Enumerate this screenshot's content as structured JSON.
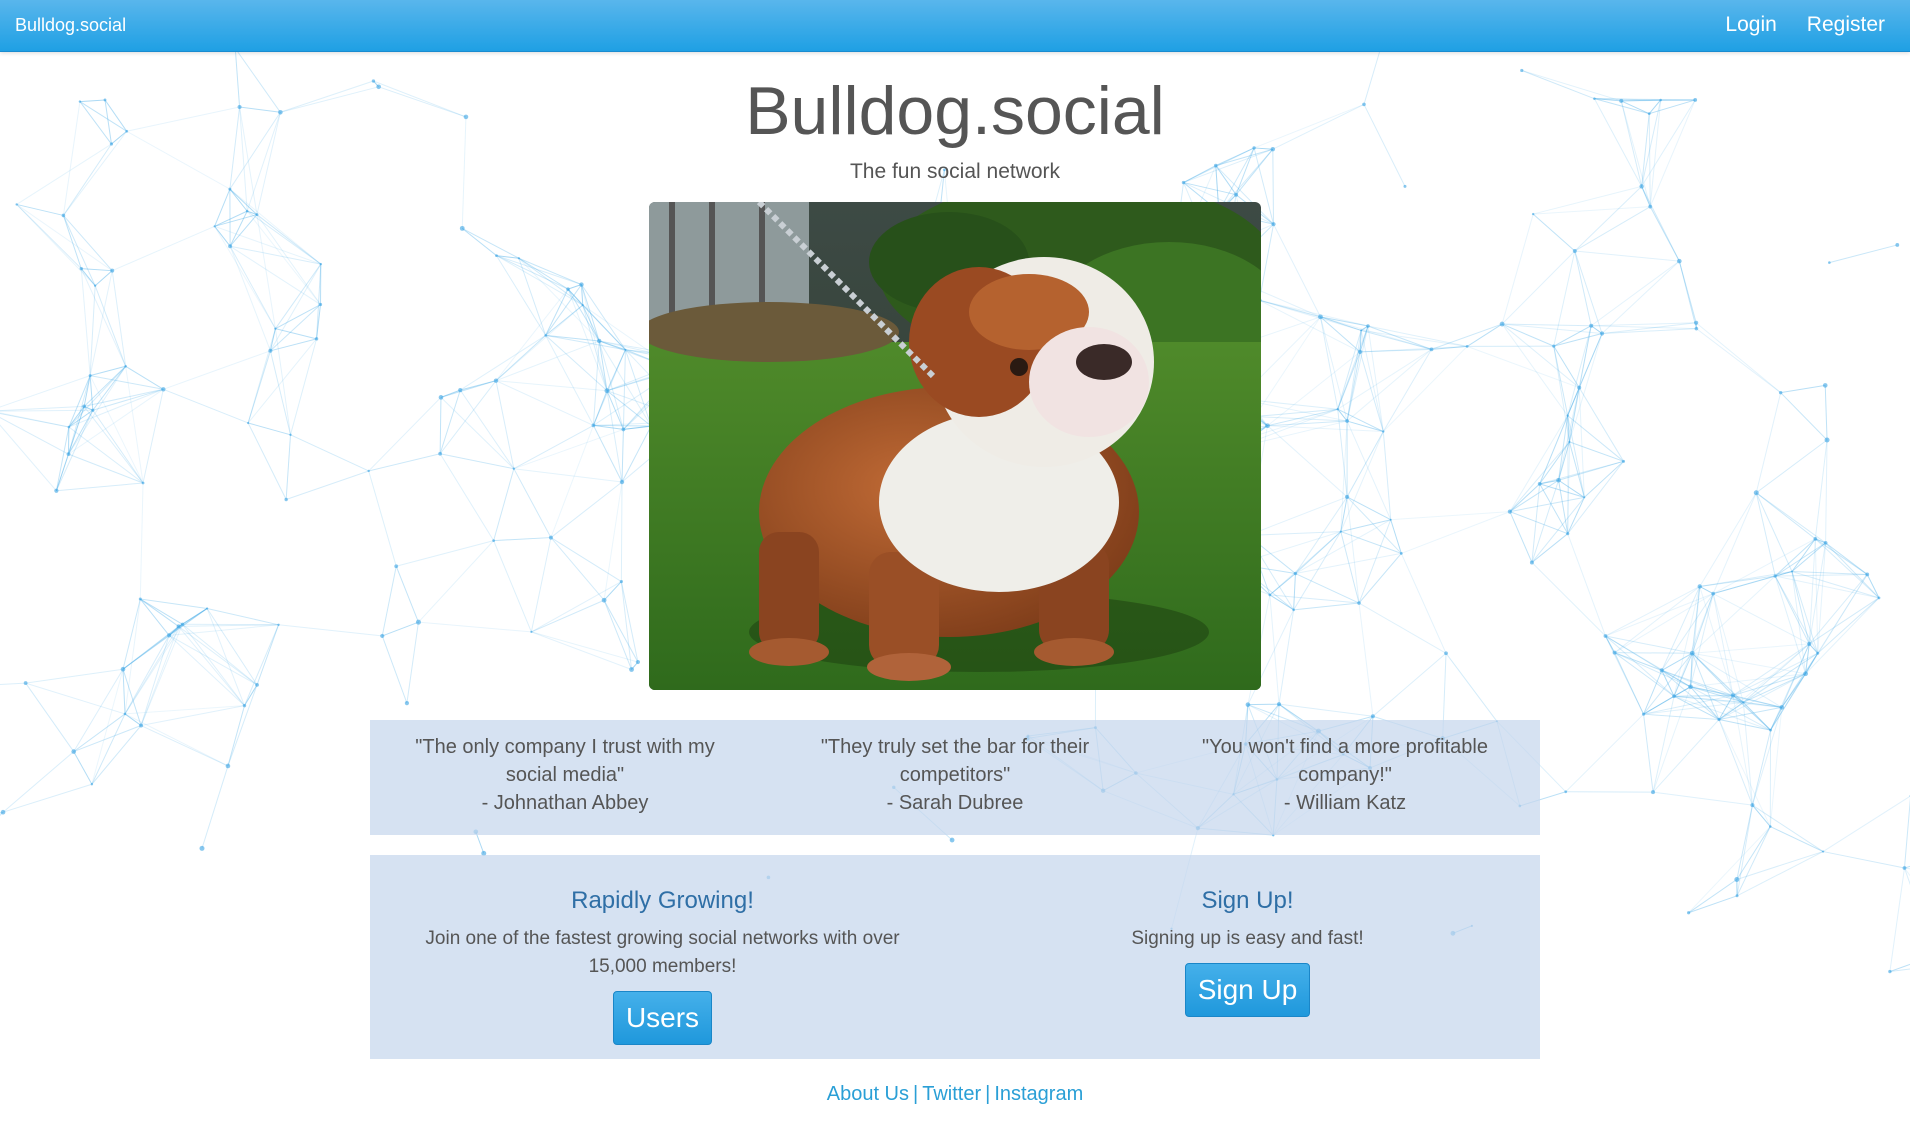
{
  "navbar": {
    "brand": "Bulldog.social",
    "links": [
      {
        "label": "Login"
      },
      {
        "label": "Register"
      }
    ]
  },
  "hero": {
    "title": "Bulldog.social",
    "tagline": "The fun social network"
  },
  "testimonials": [
    {
      "quote": "\"The only company I trust with my social media\"",
      "author": "- Johnathan Abbey"
    },
    {
      "quote": "\"They truly set the bar for their competitors\"",
      "author": "- Sarah Dubree"
    },
    {
      "quote": "\"You won't find a more profitable company!\"",
      "author": "- William Katz"
    }
  ],
  "features": {
    "growing": {
      "heading": "Rapidly Growing!",
      "text": "Join one of the fastest growing social networks with over 15,000 members!",
      "button": "Users"
    },
    "signup": {
      "heading": "Sign Up!",
      "text": "Signing up is easy and fast!",
      "button": "Sign Up"
    }
  },
  "footer": {
    "links": [
      {
        "label": "About Us"
      },
      {
        "label": "Twitter"
      },
      {
        "label": "Instagram"
      }
    ],
    "separator": "|"
  },
  "colors": {
    "accent": "#1fa0e4",
    "link": "#2a9fd6",
    "panel": "#c5d5ec"
  }
}
